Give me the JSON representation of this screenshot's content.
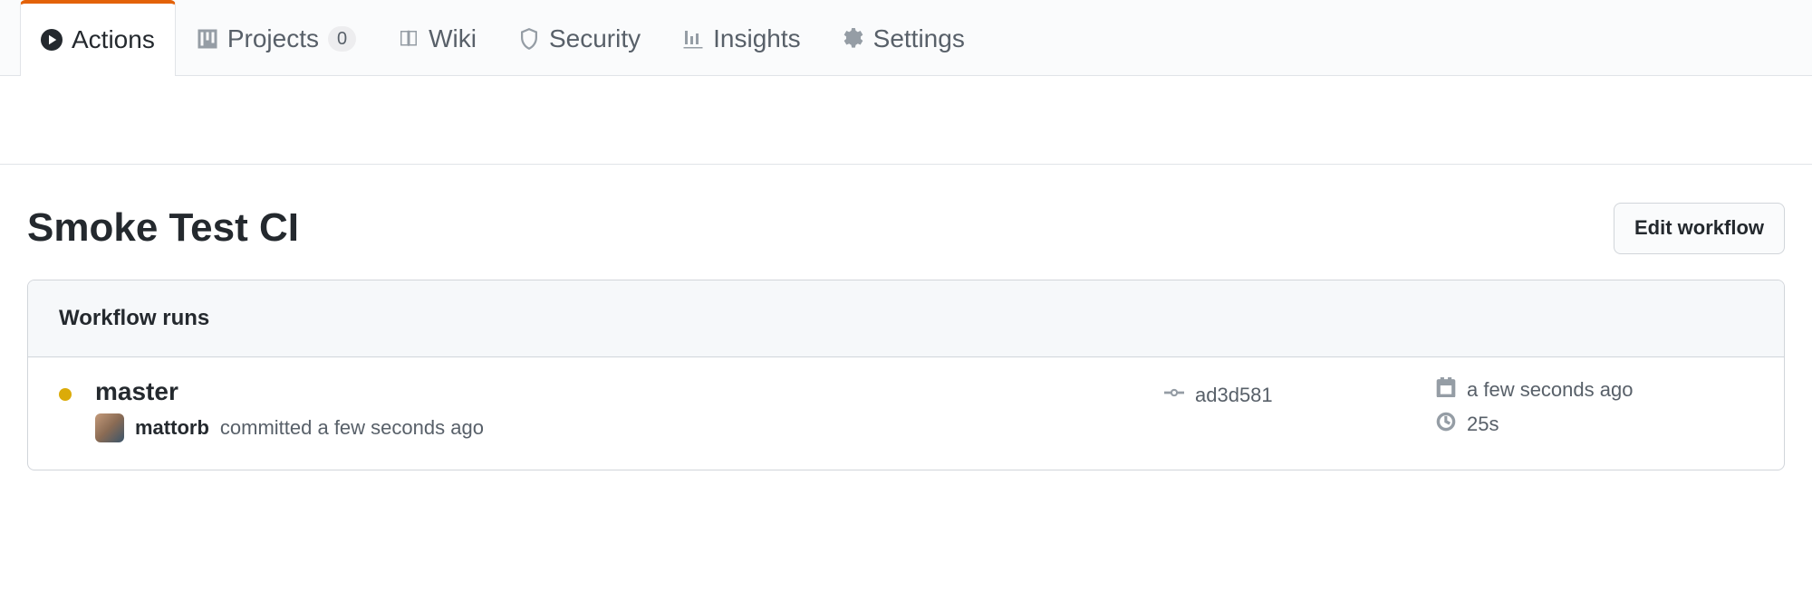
{
  "tabs": {
    "actions": "Actions",
    "projects": "Projects",
    "projects_count": "0",
    "wiki": "Wiki",
    "security": "Security",
    "insights": "Insights",
    "settings": "Settings"
  },
  "header": {
    "title": "Smoke Test CI",
    "edit_button": "Edit workflow"
  },
  "box": {
    "header": "Workflow runs"
  },
  "run": {
    "title": "master",
    "author": "mattorb",
    "commit_action": "committed a few seconds ago",
    "sha": "ad3d581",
    "time_ago": "a few seconds ago",
    "duration": "25s"
  }
}
